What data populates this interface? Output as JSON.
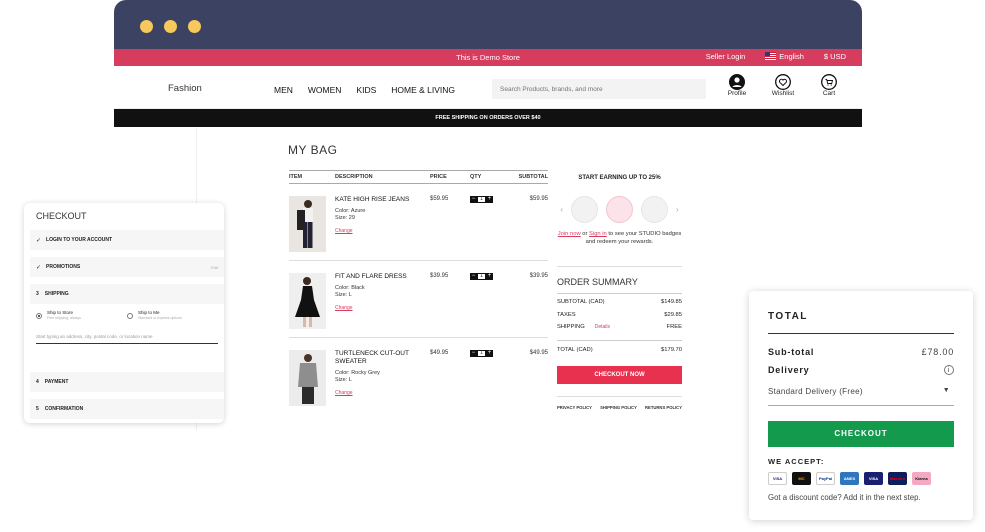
{
  "store": {
    "banner": "This is Demo Store",
    "seller_login": "Seller Login",
    "language": "English",
    "currency": "$ USD",
    "logo": "Fashion",
    "nav": [
      "MEN",
      "WOMEN",
      "KIDS",
      "HOME & LIVING"
    ],
    "search_placeholder": "Search Products, brands, and more",
    "icons": [
      {
        "label": "Profile",
        "icon": "profile-icon"
      },
      {
        "label": "Wishlist",
        "icon": "heart-icon"
      },
      {
        "label": "Cart",
        "icon": "cart-icon"
      }
    ],
    "shipping_banner": "FREE SHIPPING ON ORDERS OVER $40"
  },
  "bag": {
    "title": "MY BAG",
    "columns": [
      "ITEM",
      "DESCRIPTION",
      "PRICE",
      "QTY",
      "SUBTOTAL"
    ],
    "items": [
      {
        "name": "KATE HIGH RISE JEANS",
        "color": "Color: Azure",
        "size": "Size: 29",
        "change": "Change",
        "price": "$59.95",
        "qty": "1",
        "subtotal": "$59.95"
      },
      {
        "name": "FIT AND FLARE DRESS",
        "color": "Color: Black",
        "size": "Size: L",
        "change": "Change",
        "price": "$39.95",
        "qty": "1",
        "subtotal": "$39.95"
      },
      {
        "name": "TURTLENECK CUT-OUT SWEATER",
        "color": "Color: Rocky Grey",
        "size": "Size: L",
        "change": "Change",
        "price": "$49.95",
        "qty": "1",
        "subtotal": "$49.95"
      }
    ]
  },
  "rewards": {
    "title": "START EARNING UP TO 25%",
    "join": "Join now",
    "or": "or",
    "signin": "Sign in",
    "text": "to see your STUDIO badges and redeem your rewards."
  },
  "summary": {
    "title": "ORDER SUMMARY",
    "subtotal_label": "SUBTOTAL (CAD)",
    "subtotal": "$149.85",
    "taxes_label": "TAXES",
    "taxes": "$29.85",
    "shipping_label": "SHIPPING",
    "shipping_details": "Details",
    "shipping": "FREE",
    "total_label": "TOTAL (CAD)",
    "total": "$179.70",
    "checkout": "CHECKOUT NOW",
    "policies": [
      "PRIVACY POLICY",
      "SHIPPING POLICY",
      "RETURNS POLICY"
    ]
  },
  "checkout": {
    "title": "CHECKOUT",
    "login": "LOGIN TO YOUR ACCOUNT",
    "promotions": "PROMOTIONS",
    "promotions_tag": "Edit",
    "shipping_num": "3",
    "shipping": "SHIPPING",
    "store_opt": "Ship to Store",
    "store_sub": "Free shipping, always",
    "me_opt": "Ship to Me",
    "me_sub": "Standard or express options",
    "address_placeholder": "Start typing an address, city, postal code, or location name",
    "payment_num": "4",
    "payment": "PAYMENT",
    "confirm_num": "5",
    "confirm": "CONFIRMATION"
  },
  "total": {
    "title": "TOTAL",
    "subtotal_label": "Sub-total",
    "subtotal": "£78.00",
    "delivery_label": "Delivery",
    "delivery_option": "Standard Delivery (Free)",
    "checkout": "CHECKOUT",
    "accept": "WE ACCEPT:",
    "cards": [
      "VISA",
      "MC",
      "PayPal",
      "AMEX",
      "VISA",
      "Maestro",
      "Klarna"
    ],
    "note": "Got a discount code? Add it in the next step."
  },
  "colors": {
    "chrome": "#3b4262",
    "accent": "#d63c5e",
    "checkout_green": "#149a4d",
    "traffic_light": "#f7c95c"
  }
}
